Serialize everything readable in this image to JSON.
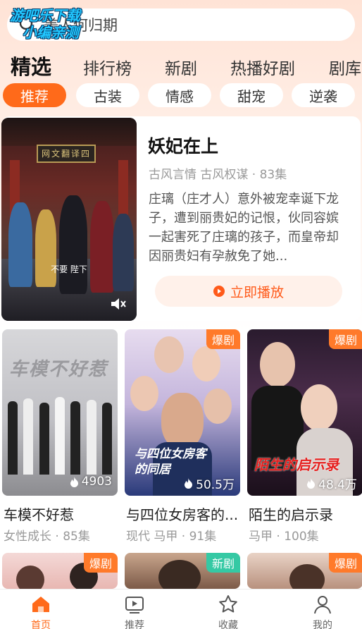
{
  "watermark": {
    "line1": "游吧乐下载",
    "line2": "小编亲测"
  },
  "search": {
    "placeholder": "美人何归期",
    "icon": "search-icon"
  },
  "main_tabs": [
    "精选",
    "排行榜",
    "新剧",
    "热播好剧",
    "剧库"
  ],
  "sub_tabs": [
    "推荐",
    "古装",
    "情感",
    "甜宠",
    "逆袭"
  ],
  "featured": {
    "title": "妖妃在上",
    "meta": "古风言情 古风权谋 · 83集",
    "description": "庄璃（庄才人）意外被宠幸诞下龙子，遭到丽贵妃的记恨，伙同容嫔一起害死了庄璃的孩子，而皇帝却因丽贵妇有孕赦免了她...",
    "poster_sign": "网文翻译四",
    "poster_subtitle": "不要 陛下",
    "play_label": "立即播放",
    "mute_icon": "mute-icon"
  },
  "dramas": [
    {
      "title": "车模不好惹",
      "meta": "女性成长 · 85集",
      "views": "4903",
      "badge": "",
      "poster_text": "车模不好惹"
    },
    {
      "title": "与四位女房客的...",
      "meta": "现代 马甲 · 91集",
      "views": "50.5万",
      "badge": "爆剧",
      "poster_text": "与四位女房客的同居"
    },
    {
      "title": "陌生的启示录",
      "meta": "马甲 · 100集",
      "views": "48.4万",
      "badge": "爆剧",
      "poster_text": "陌生的启示录"
    },
    {
      "badge": "爆剧"
    },
    {
      "badge": "新剧"
    },
    {
      "badge": "爆剧"
    }
  ],
  "bottom_nav": [
    {
      "label": "首页",
      "icon": "home-icon",
      "active": true
    },
    {
      "label": "推荐",
      "icon": "play-box-icon",
      "active": false
    },
    {
      "label": "收藏",
      "icon": "star-icon",
      "active": false
    },
    {
      "label": "我的",
      "icon": "user-icon",
      "active": false
    }
  ],
  "colors": {
    "accent": "#ff6a1a",
    "badge_hot": "#ff7a2a",
    "badge_new": "#35c9a4"
  }
}
